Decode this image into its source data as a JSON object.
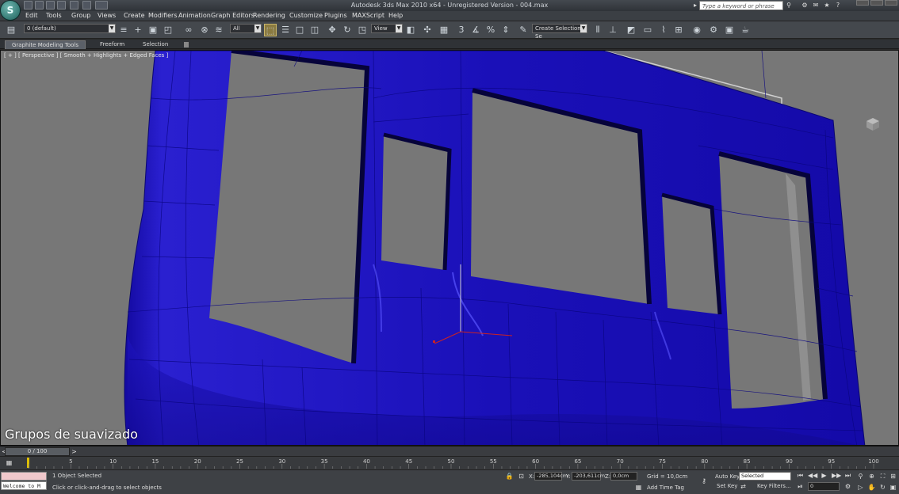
{
  "title_bar": {
    "title": "Autodesk 3ds Max 2010 x64 - Unregistered Version - 004.max",
    "search_placeholder": "Type a keyword or phrase",
    "app_button_glyph": "S"
  },
  "menu": {
    "items": [
      "Edit",
      "Tools",
      "Group",
      "Views",
      "Create",
      "Modifiers",
      "Animation",
      "Graph Editors",
      "Rendering",
      "Customize",
      "Plugins",
      "MAXScript",
      "Help"
    ]
  },
  "toolbar": {
    "layer_dropdown": "0 (default)",
    "selection_filter": "All",
    "reference_coord": "View",
    "named_selection": "Create Selection Se",
    "snap_label": "3"
  },
  "ribbon": {
    "tabs": [
      "Graphite Modeling Tools",
      "Freeform",
      "Selection"
    ]
  },
  "viewport": {
    "label": "[ + ] [ Perspective ] [ Smooth + Highlights + Edged Faces ]",
    "caption": "Grupos de suavizado",
    "mesh_color": "#1a10b0",
    "background_color": "#777777"
  },
  "timeline": {
    "slider_label": "0 / 100",
    "ticks": [
      "0",
      "5",
      "10",
      "15",
      "20",
      "25",
      "30",
      "35",
      "40",
      "45",
      "50",
      "55",
      "60",
      "65",
      "70",
      "75",
      "80",
      "85",
      "90",
      "95",
      "100"
    ]
  },
  "status": {
    "maxscript_welcome": "Welcome to M",
    "selection_info": "1 Object Selected",
    "prompt": "Click or click-and-drag to select objects",
    "x_label": "X:",
    "x_value": "-285,104cm",
    "y_label": "Y:",
    "y_value": "-203,611cm",
    "z_label": "Z:",
    "z_value": "0,0cm",
    "grid": "Grid = 10,0cm",
    "add_time_tag": "Add Time Tag",
    "auto_key": "Auto Key",
    "set_key": "Set Key",
    "key_mode_dropdown": "Selected",
    "key_filters": "Key Filters...",
    "current_frame": "0"
  }
}
